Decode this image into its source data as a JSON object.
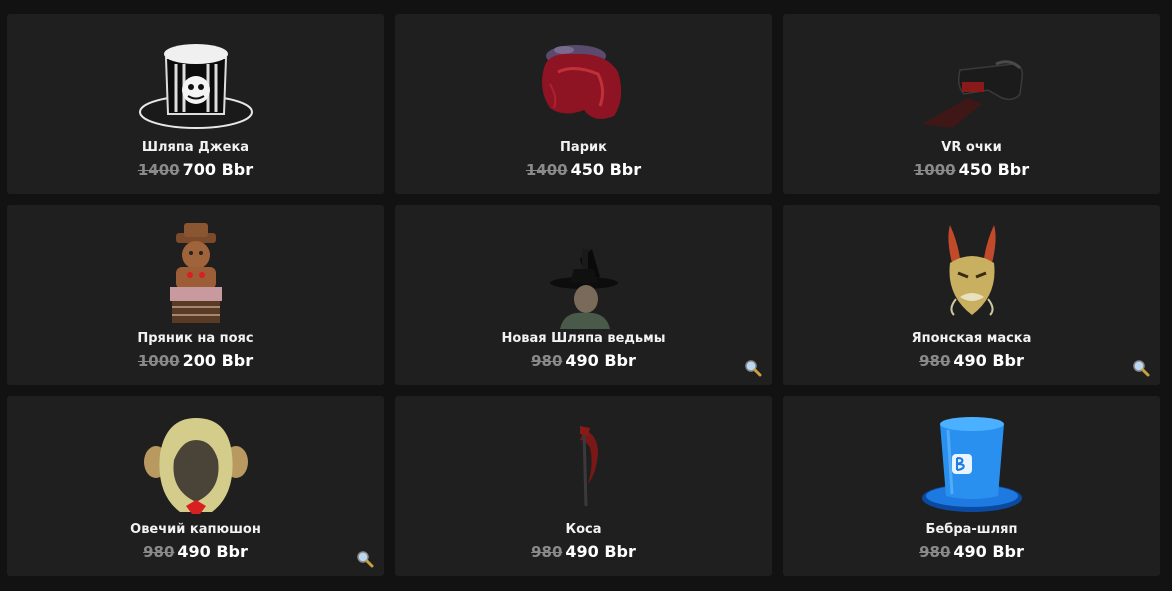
{
  "currency": "Bbr",
  "items": [
    {
      "name": "Шляпа Джека",
      "old_price": "1400",
      "new_price": "700 Bbr",
      "icon": "jack-hat-icon",
      "zoom": false
    },
    {
      "name": "Парик",
      "old_price": "1400",
      "new_price": "450 Bbr",
      "icon": "wig-icon",
      "zoom": false
    },
    {
      "name": "VR очки",
      "old_price": "1000",
      "new_price": "450 Bbr",
      "icon": "vr-glasses-icon",
      "zoom": false
    },
    {
      "name": "Пряник на пояс",
      "old_price": "1000",
      "new_price": "200 Bbr",
      "icon": "gingerbread-icon",
      "zoom": false
    },
    {
      "name": "Новая Шляпа ведьмы",
      "old_price": "980",
      "new_price": "490 Bbr",
      "icon": "witch-hat-icon",
      "zoom": true
    },
    {
      "name": "Японская маска",
      "old_price": "980",
      "new_price": "490 Bbr",
      "icon": "japanese-mask-icon",
      "zoom": true
    },
    {
      "name": "Овечий капюшон",
      "old_price": "980",
      "new_price": "490 Bbr",
      "icon": "sheep-hood-icon",
      "zoom": true
    },
    {
      "name": "Коса",
      "old_price": "980",
      "new_price": "490 Bbr",
      "icon": "scythe-icon",
      "zoom": false
    },
    {
      "name": "Бебра-шляп",
      "old_price": "980",
      "new_price": "490 Bbr",
      "icon": "bebra-hat-icon",
      "zoom": false
    }
  ]
}
